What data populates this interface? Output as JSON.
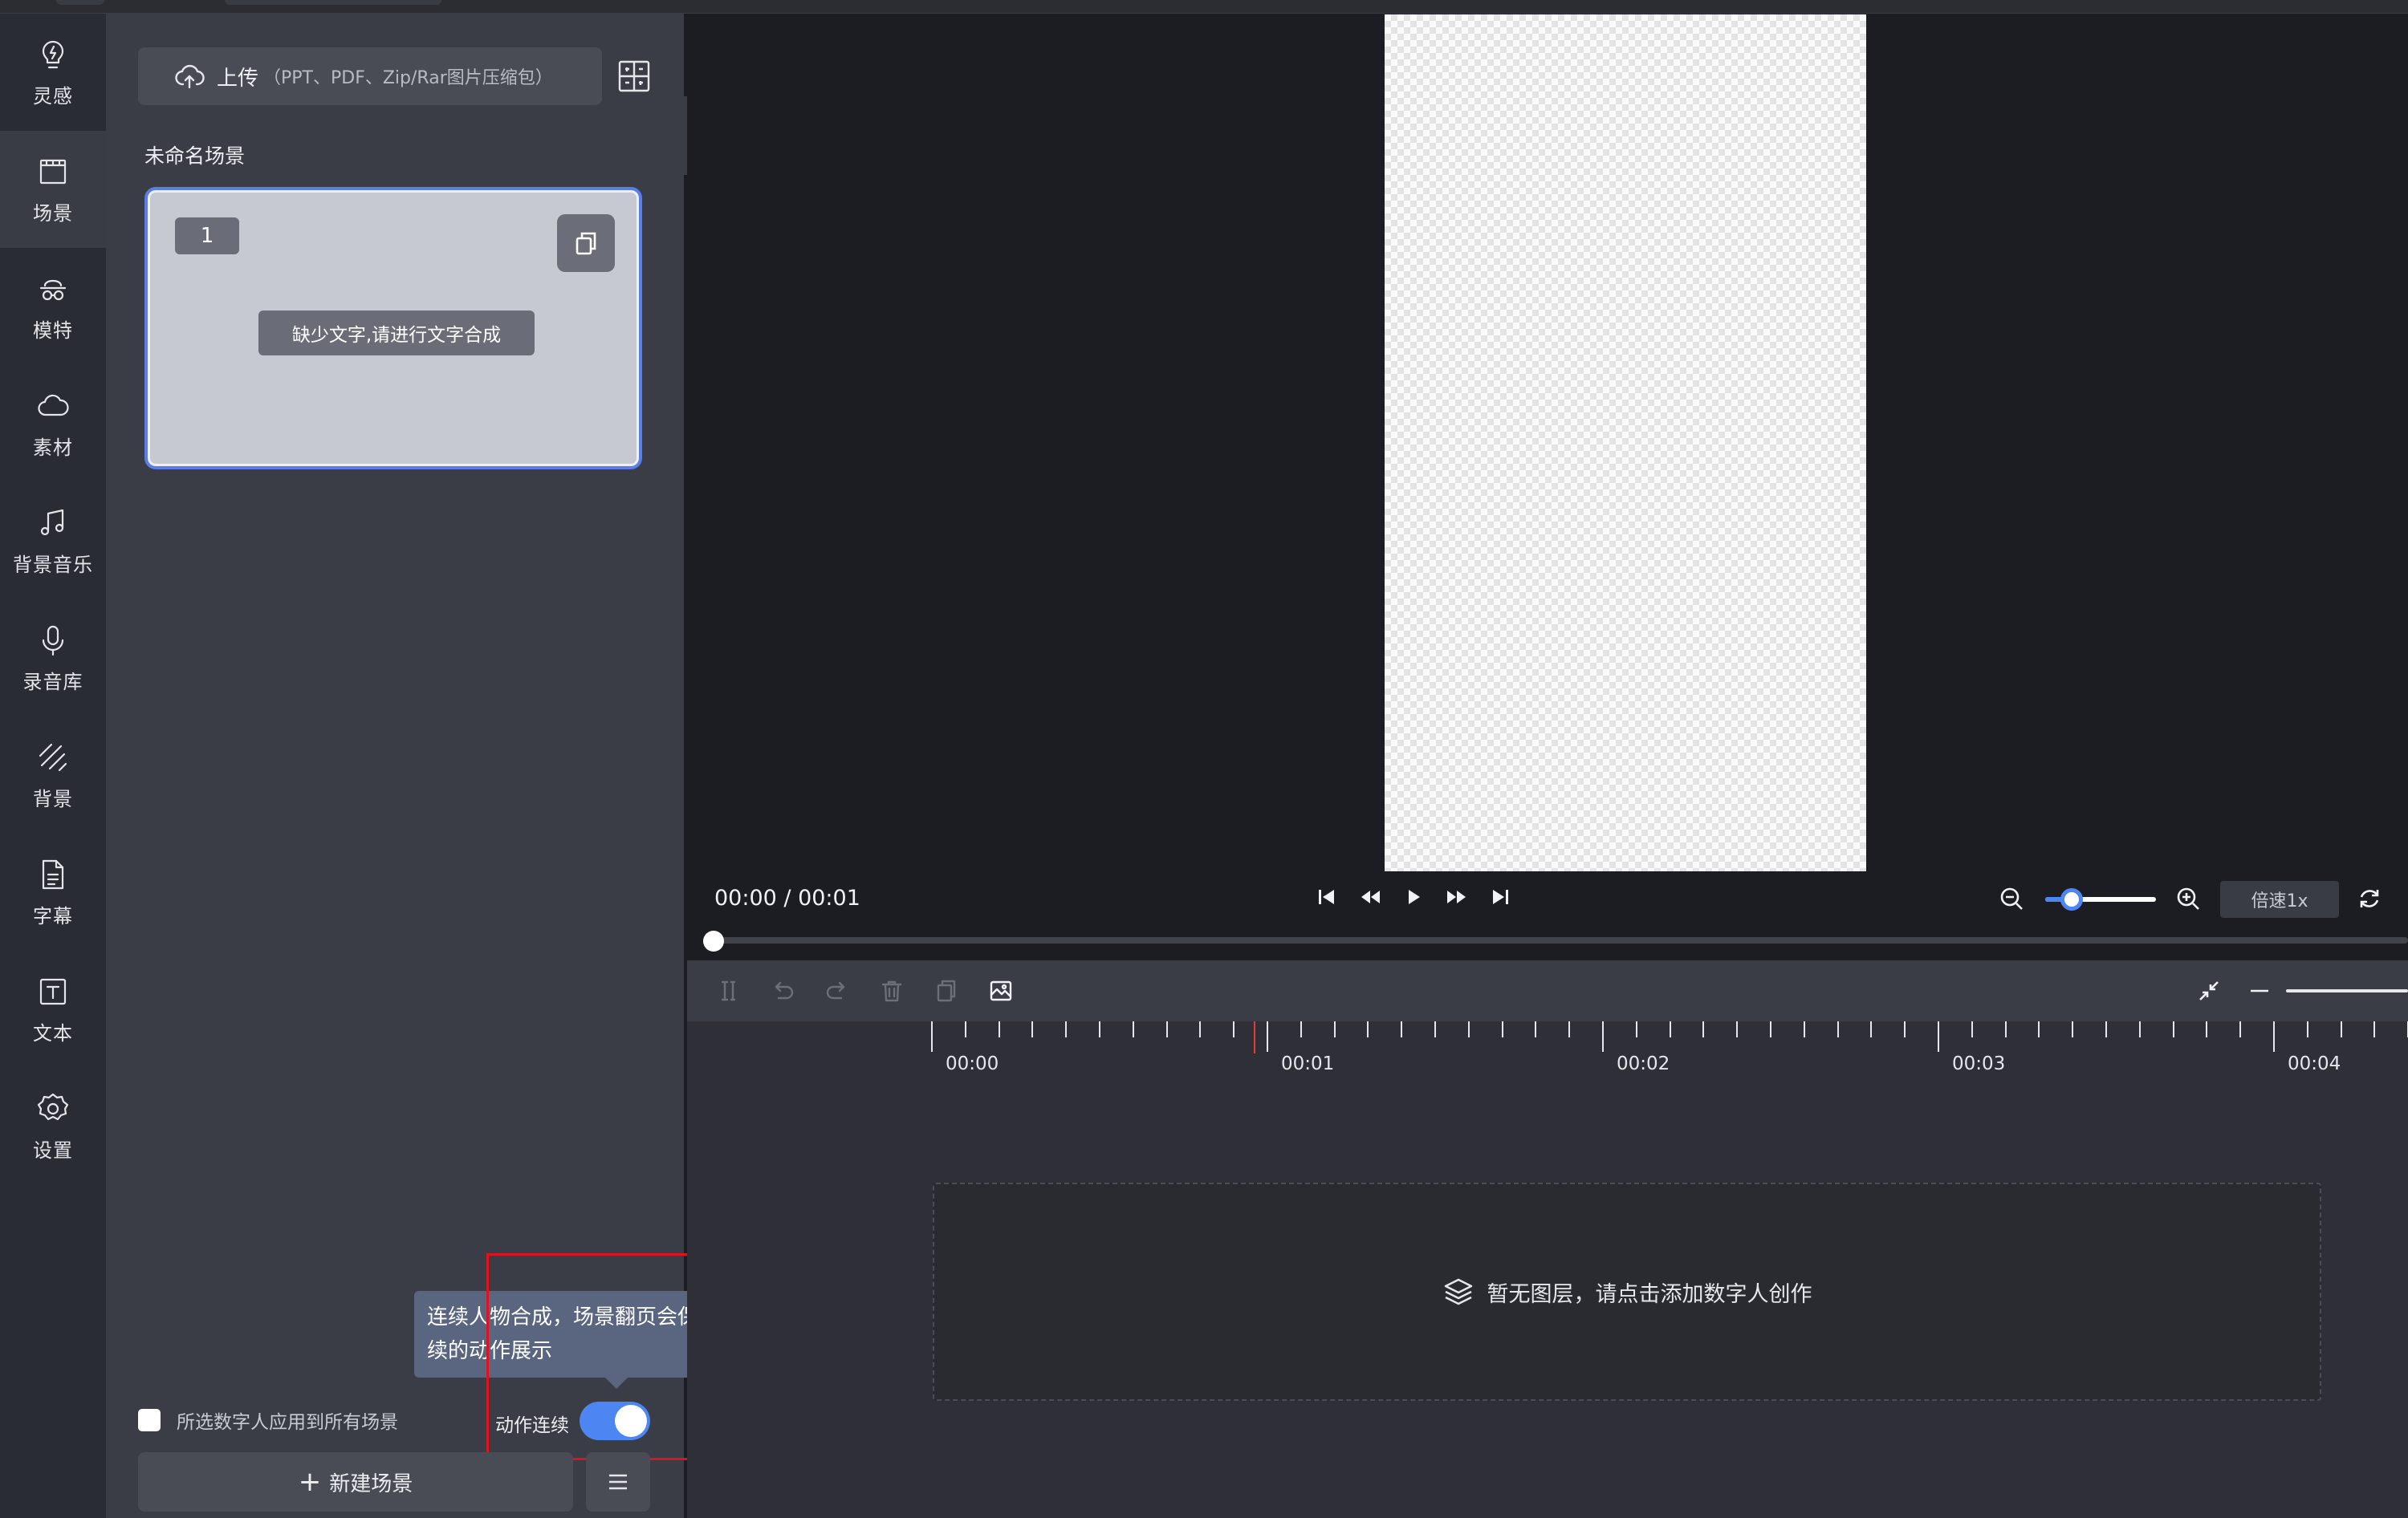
{
  "nav": {
    "items": [
      {
        "label": "灵感",
        "icon": "lightbulb-icon"
      },
      {
        "label": "场景",
        "icon": "clapper-icon"
      },
      {
        "label": "模特",
        "icon": "figure-icon"
      },
      {
        "label": "素材",
        "icon": "cloud-icon"
      },
      {
        "label": "背景音乐",
        "icon": "music-note-icon"
      },
      {
        "label": "录音库",
        "icon": "microphone-icon"
      },
      {
        "label": "背景",
        "icon": "diagonal-lines-icon"
      },
      {
        "label": "字幕",
        "icon": "document-icon"
      },
      {
        "label": "文本",
        "icon": "text-box-icon"
      },
      {
        "label": "设置",
        "icon": "gear-icon"
      }
    ],
    "active_index": 1
  },
  "panel": {
    "upload_main": "上传",
    "upload_sub": "（PPT、PDF、Zip/Rar图片压缩包）",
    "scene_group_title": "未命名场景",
    "scene_card": {
      "number": "1",
      "warning": "缺少文字,请进行文字合成"
    },
    "apply_all_label": "所选数字人应用到所有场景",
    "motion_label": "动作连续",
    "motion_tooltip": "连续人物合成，场景翻页会保证数字人连续的动作展示",
    "new_scene_label": "新建场景",
    "motion_enabled": true
  },
  "player": {
    "timecode": "00:00 / 00:01",
    "speed_label": "倍速1x",
    "zoom_level": 0.15
  },
  "timeline": {
    "ticks": [
      "00:00",
      "00:01",
      "00:02",
      "00:03",
      "00:04"
    ],
    "empty_text": "暂无图层，请点击添加数字人创作"
  },
  "colors": {
    "accent": "#4d86f2",
    "highlight_box": "#e1121f"
  }
}
